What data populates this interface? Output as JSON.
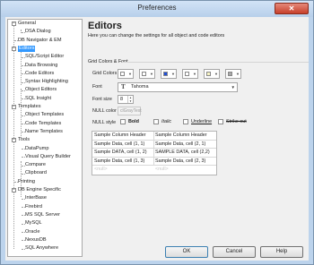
{
  "window": {
    "title": "Preferences"
  },
  "tree": [
    {
      "label": "General",
      "level": 0,
      "expander": "−"
    },
    {
      "label": "DSA Dialog",
      "level": 1
    },
    {
      "label": "DB Navigator & EM",
      "level": 0
    },
    {
      "label": "Editors",
      "level": 0,
      "expander": "−",
      "selected": true
    },
    {
      "label": "SQL/Script Editor",
      "level": 1
    },
    {
      "label": "Data Browsing",
      "level": 1
    },
    {
      "label": "Code Editors",
      "level": 1
    },
    {
      "label": "Syntax Highlighting",
      "level": 1
    },
    {
      "label": "Object Editors",
      "level": 1
    },
    {
      "label": "SQL Insight",
      "level": 1
    },
    {
      "label": "Templates",
      "level": 0,
      "expander": "−"
    },
    {
      "label": "Object Templates",
      "level": 1
    },
    {
      "label": "Code Templates",
      "level": 1
    },
    {
      "label": "Name Templates",
      "level": 1
    },
    {
      "label": "Tools",
      "level": 0,
      "expander": "−"
    },
    {
      "label": "DataPump",
      "level": 1
    },
    {
      "label": "Visual Query Builder",
      "level": 1
    },
    {
      "label": "Compare",
      "level": 1
    },
    {
      "label": "Clipboard",
      "level": 1
    },
    {
      "label": "Printing",
      "level": 0
    },
    {
      "label": "DB Engine Specific",
      "level": 0,
      "expander": "−"
    },
    {
      "label": "InterBase",
      "level": 1
    },
    {
      "label": "Firebird",
      "level": 1
    },
    {
      "label": "MS SQL Server",
      "level": 1
    },
    {
      "label": "MySQL",
      "level": 1
    },
    {
      "label": "Oracle",
      "level": 1
    },
    {
      "label": "NexusDB",
      "level": 1
    },
    {
      "label": "SQL Anywhere",
      "level": 1
    }
  ],
  "editors": {
    "heading": "Editors",
    "description": "Here you can change the settings for all object and code editors"
  },
  "group": {
    "title": "Grid Colors & Font",
    "grid_colors_label": "Grid Colors",
    "swatches": [
      "#ffffff",
      "#ffffff",
      "#1f4fd6",
      "#ffffff",
      "#f6f3c4",
      "#a8a8a8"
    ],
    "font_label": "Font",
    "font_value": "Tahoma",
    "font_size_label": "Font size",
    "font_size_value": "8",
    "null_color_label": "NULL color",
    "null_color_value": "clGrayText",
    "null_style_label": "NULL style",
    "style_bold": "Bold",
    "style_italic": "Italic",
    "style_underline": "Underline",
    "style_strikeout": "Strike out"
  },
  "sample": {
    "header": [
      "Sample Column Header",
      "Sample Column Header"
    ],
    "rows": [
      [
        "Sample Data, cell (1, 1)",
        "Sample Data, cell (2, 1)"
      ],
      [
        "Sample DATA, cell (1, 2)",
        "SAMPLE DATA, cell (2,2)"
      ],
      [
        "Sample Data, cell (1, 3)",
        "Sample Data, cell (2, 3)"
      ],
      [
        "<null>",
        "<null>"
      ]
    ]
  },
  "buttons": {
    "ok": "OK",
    "cancel": "Cancel",
    "help": "Help"
  }
}
